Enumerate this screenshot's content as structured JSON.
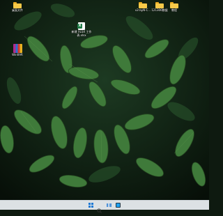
{
  "desktop": {
    "wallpaper": "dark green leaves",
    "icons": [
      {
        "label": "桌面文件",
        "type": "folder"
      },
      {
        "label": "v2rayN-C...",
        "type": "folder"
      },
      {
        "label": "121306数据",
        "type": "folder"
      },
      {
        "label": "教程",
        "type": "folder"
      },
      {
        "label": "新建 XLSX 工作表.xlsx",
        "type": "excel"
      },
      {
        "label": "WinRAR",
        "type": "winrar"
      }
    ]
  },
  "taskbar": {
    "items": [
      "start-icon",
      "search-icon",
      "task-view-icon",
      "pinned-app-icon"
    ],
    "accent": "#1b78d4"
  },
  "colors": {
    "folder": "#f7c948",
    "excel": "#1d7a43",
    "taskbar": "#e8ecf0"
  }
}
